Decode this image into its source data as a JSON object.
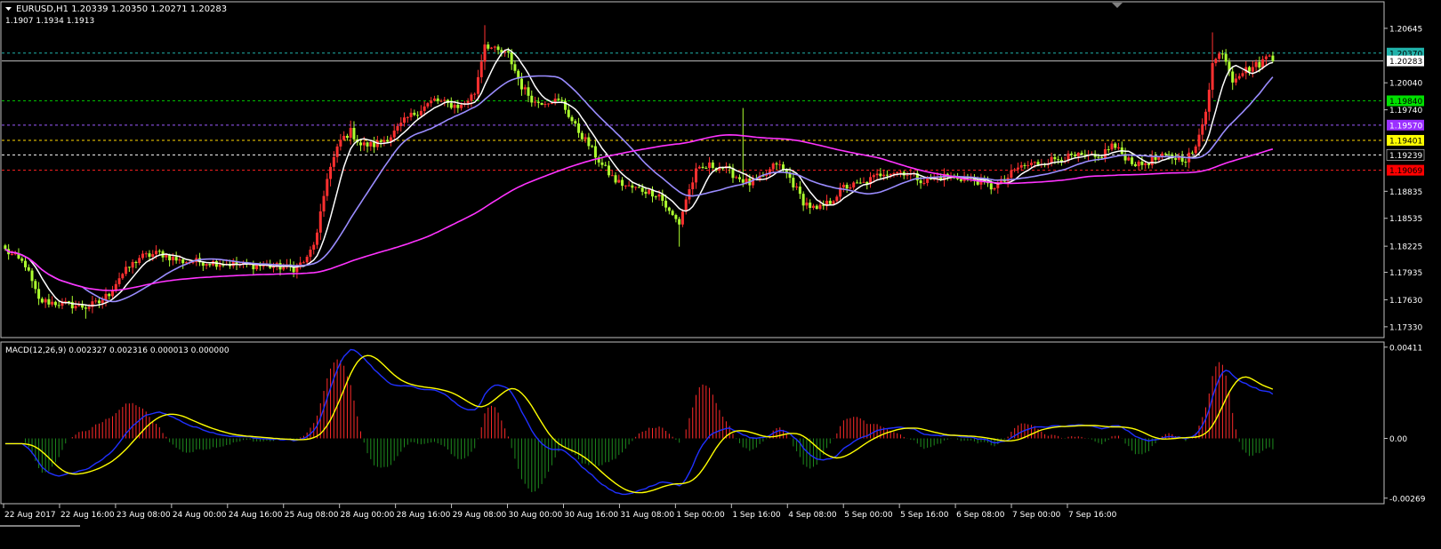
{
  "header": {
    "symbol_line": "EURUSD,H1  1.20339 1.20350 1.20271 1.20283",
    "sub_line": "1.1907 1.1934 1.1913"
  },
  "colors": {
    "background": "#000000",
    "frame": "#c0c0c0",
    "bull": "#ff3030",
    "bear": "#adff2f",
    "fast_ma": "#ffffff",
    "mid_ma": "#9a8cff",
    "slow_ma": "#ff33ff",
    "macd_line": "#2030ff",
    "signal_line": "#ffff00",
    "hist_pos": "#ff2a2a",
    "hist_neg": "#1e8c1e"
  },
  "chart_data": [
    {
      "type": "candlestick",
      "title": "EURUSD,H1  1.20339 1.20350 1.20271 1.20283",
      "subtitle": "1.1907 1.1934 1.1913",
      "ylim": [
        1.1722,
        1.2093
      ],
      "y_ticks": [
        "1.20645",
        "1.20040",
        "1.19740",
        "1.18835",
        "1.18535",
        "1.18225",
        "1.17935",
        "1.17630",
        "1.17330"
      ],
      "x_ticks": [
        "22 Aug 2017",
        "22 Aug 16:00",
        "23 Aug 08:00",
        "24 Aug 00:00",
        "24 Aug 16:00",
        "25 Aug 08:00",
        "28 Aug 00:00",
        "28 Aug 16:00",
        "29 Aug 08:00",
        "30 Aug 00:00",
        "30 Aug 16:00",
        "31 Aug 08:00",
        "1 Sep 00:00",
        "1 Sep 16:00",
        "4 Sep 08:00",
        "5 Sep 00:00",
        "5 Sep 16:00",
        "6 Sep 08:00",
        "7 Sep 00:00",
        "7 Sep 16:00"
      ],
      "price_levels": [
        {
          "label": "1.20370",
          "value": 1.2037,
          "color": "#20b2aa",
          "style": "dashed",
          "label_bg": "#20b2aa",
          "label_fg": "#000000"
        },
        {
          "label": "1.20283",
          "value": 1.20283,
          "color": "#c0c0c0",
          "style": "solid",
          "label_bg": "#ffffff",
          "label_fg": "#000000"
        },
        {
          "label": "1.19840",
          "value": 1.1984,
          "color": "#00c000",
          "style": "dashed",
          "label_bg": "#00e000",
          "label_fg": "#000000"
        },
        {
          "label": "1.19570",
          "value": 1.1957,
          "color": "#9b59ff",
          "style": "dashed",
          "label_bg": "#9b30ff",
          "label_fg": "#ffffff"
        },
        {
          "label": "1.19401",
          "value": 1.19401,
          "color": "#ffd700",
          "style": "dashed",
          "label_bg": "#ffff00",
          "label_fg": "#000000"
        },
        {
          "label": "1.19239",
          "value": 1.19239,
          "color": "#ffffff",
          "style": "dashed",
          "label_bg": "#000000",
          "label_fg": "#ffffff"
        },
        {
          "label": "1.19069",
          "value": 1.19069,
          "color": "#ff2020",
          "style": "dashed",
          "label_bg": "#ff0000",
          "label_fg": "#000000"
        }
      ],
      "close_anchors": [
        [
          0,
          1.1818
        ],
        [
          6,
          1.1802
        ],
        [
          10,
          1.1762
        ],
        [
          18,
          1.1758
        ],
        [
          24,
          1.1755
        ],
        [
          28,
          1.176
        ],
        [
          31,
          1.177
        ],
        [
          34,
          1.1788
        ],
        [
          40,
          1.181
        ],
        [
          46,
          1.1815
        ],
        [
          52,
          1.1806
        ],
        [
          60,
          1.1805
        ],
        [
          70,
          1.1802
        ],
        [
          80,
          1.18
        ],
        [
          86,
          1.1798
        ],
        [
          90,
          1.1808
        ],
        [
          93,
          1.1835
        ],
        [
          96,
          1.19
        ],
        [
          100,
          1.194
        ],
        [
          103,
          1.195
        ],
        [
          106,
          1.1935
        ],
        [
          110,
          1.1935
        ],
        [
          115,
          1.1945
        ],
        [
          120,
          1.1965
        ],
        [
          124,
          1.1975
        ],
        [
          128,
          1.1985
        ],
        [
          132,
          1.198
        ],
        [
          136,
          1.1978
        ],
        [
          140,
          1.1993
        ],
        [
          143,
          1.2048
        ],
        [
          146,
          1.204
        ],
        [
          150,
          1.2035
        ],
        [
          154,
          1.2
        ],
        [
          158,
          1.1982
        ],
        [
          163,
          1.1985
        ],
        [
          166,
          1.1982
        ],
        [
          170,
          1.1955
        ],
        [
          174,
          1.1935
        ],
        [
          178,
          1.1912
        ],
        [
          182,
          1.1895
        ],
        [
          186,
          1.1888
        ],
        [
          190,
          1.1885
        ],
        [
          195,
          1.188
        ],
        [
          198,
          1.186
        ],
        [
          201,
          1.1848
        ],
        [
          203,
          1.1875
        ],
        [
          206,
          1.1905
        ],
        [
          210,
          1.1912
        ],
        [
          214,
          1.191
        ],
        [
          218,
          1.19
        ],
        [
          222,
          1.1892
        ],
        [
          226,
          1.1898
        ],
        [
          230,
          1.1915
        ],
        [
          234,
          1.1898
        ],
        [
          238,
          1.1872
        ],
        [
          242,
          1.1862
        ],
        [
          246,
          1.1872
        ],
        [
          250,
          1.1888
        ],
        [
          256,
          1.1892
        ],
        [
          262,
          1.1905
        ],
        [
          268,
          1.1905
        ],
        [
          274,
          1.1895
        ],
        [
          280,
          1.19
        ],
        [
          286,
          1.1898
        ],
        [
          290,
          1.1895
        ],
        [
          294,
          1.1888
        ],
        [
          298,
          1.1895
        ],
        [
          302,
          1.191
        ],
        [
          308,
          1.1915
        ],
        [
          314,
          1.192
        ],
        [
          320,
          1.1922
        ],
        [
          326,
          1.192
        ],
        [
          330,
          1.1935
        ],
        [
          334,
          1.1922
        ],
        [
          338,
          1.1912
        ],
        [
          342,
          1.1918
        ],
        [
          346,
          1.1922
        ],
        [
          352,
          1.192
        ],
        [
          355,
          1.193
        ],
        [
          358,
          1.1975
        ],
        [
          360,
          1.2025
        ],
        [
          363,
          1.204
        ],
        [
          366,
          1.2008
        ],
        [
          368,
          1.2015
        ],
        [
          371,
          1.202
        ],
        [
          374,
          1.2025
        ],
        [
          377,
          1.2035
        ],
        [
          378,
          1.2028
        ]
      ],
      "series": [
        {
          "type": "candles",
          "bars": 379,
          "bull_color": "#ff3030",
          "bear_color": "#adff2f"
        },
        {
          "type": "line",
          "period": 8,
          "color": "#ffffff"
        },
        {
          "type": "line",
          "period": 24,
          "color": "#9a8cff"
        },
        {
          "type": "line",
          "period": 120,
          "color": "#ff33ff"
        }
      ]
    },
    {
      "type": "line",
      "title": "MACD(12,26,9) 0.002327 0.002316 0.000013 0.000000",
      "ylim": [
        -0.0029,
        0.0043
      ],
      "y_ticks": [
        "0.00411",
        "0.00",
        "-0.00269"
      ],
      "series": [
        {
          "type": "histogram",
          "color_pos": "#ff2a2a",
          "color_neg": "#1e8c1e"
        },
        {
          "type": "line",
          "color": "#2030ff"
        },
        {
          "type": "line",
          "color": "#ffff00"
        }
      ]
    }
  ]
}
